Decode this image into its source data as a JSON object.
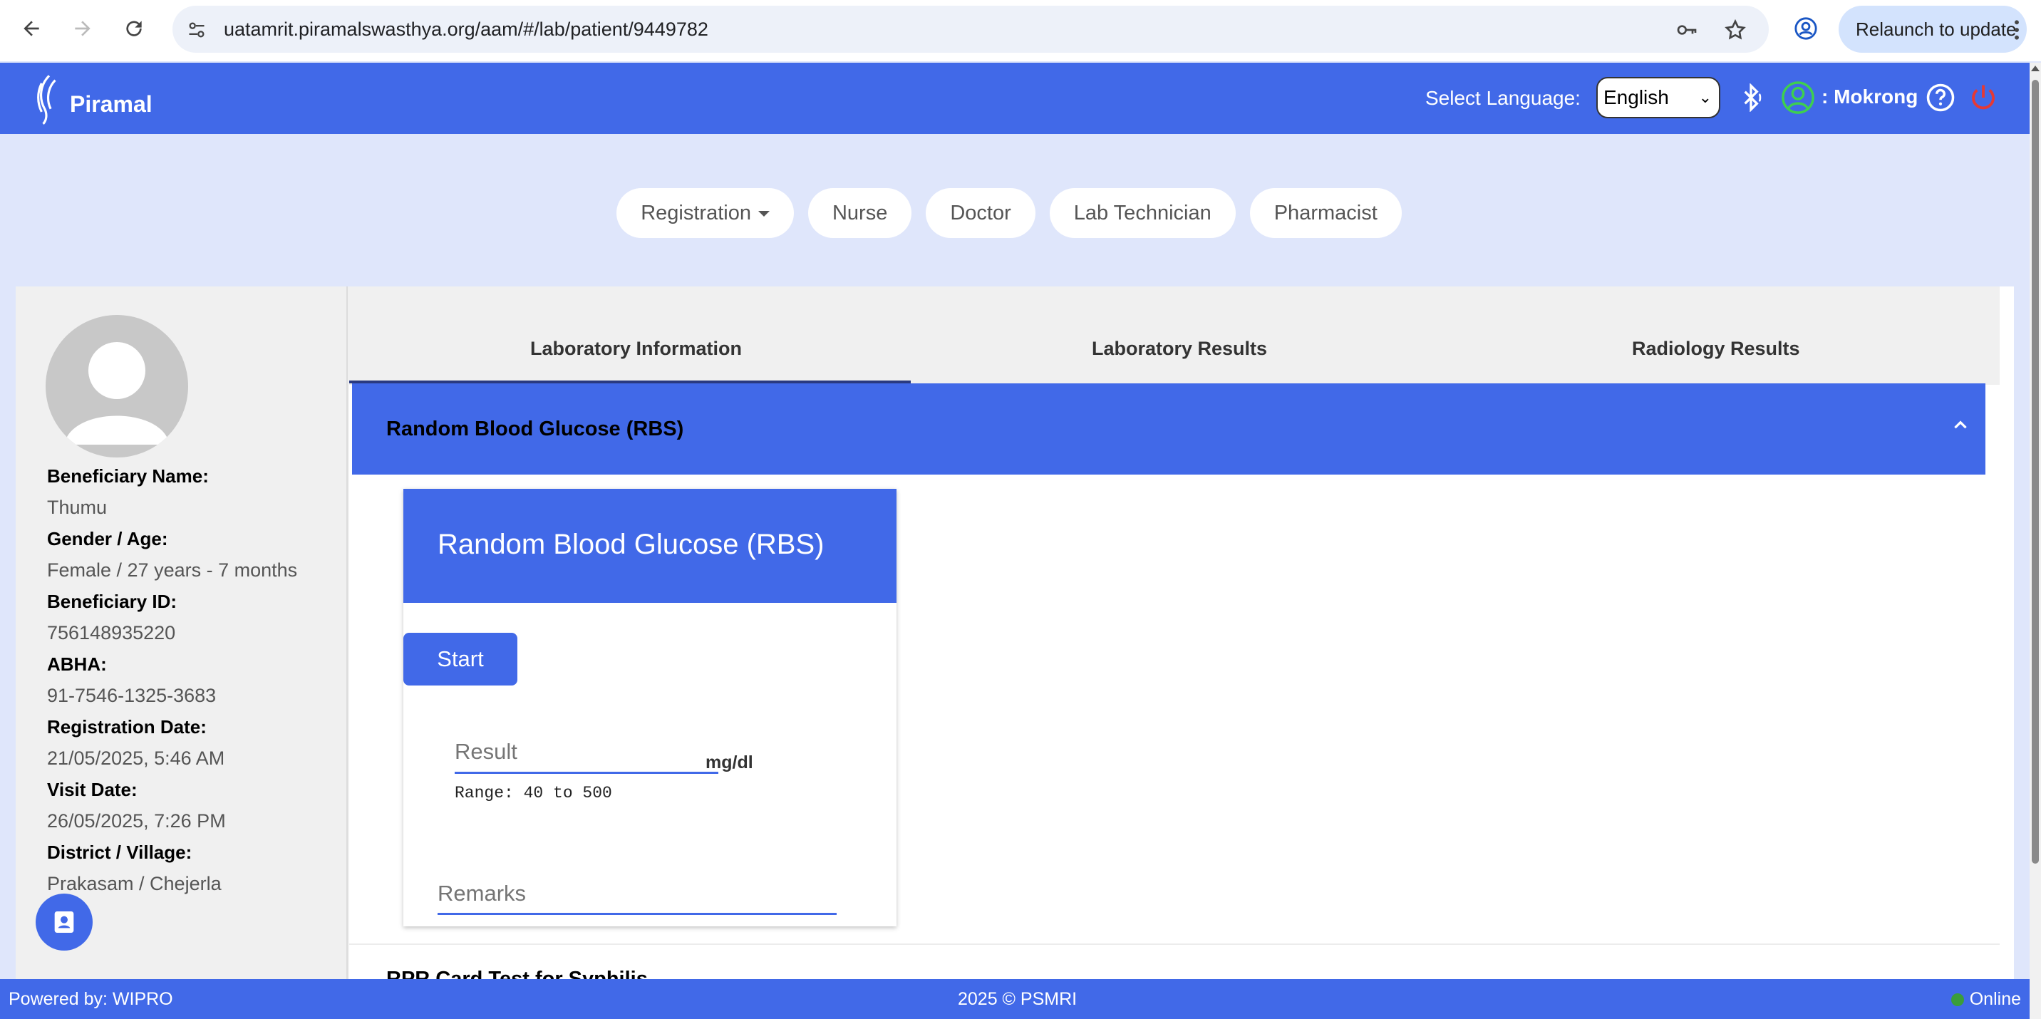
{
  "browser": {
    "url": "uatamrit.piramalswasthya.org/aam/#/lab/patient/9449782",
    "relaunch_label": "Relaunch to update"
  },
  "header": {
    "brand": "Piramal",
    "language_label": "Select Language:",
    "language_value": "English",
    "user_name": ": Mokrong",
    "colors": {
      "header_bg": "#4169e8",
      "power": "#e53935"
    }
  },
  "roles": [
    {
      "label": "Registration",
      "has_dropdown": true
    },
    {
      "label": "Nurse"
    },
    {
      "label": "Doctor"
    },
    {
      "label": "Lab Technician"
    },
    {
      "label": "Pharmacist"
    }
  ],
  "patient": {
    "fields": [
      {
        "label": "Beneficiary Name:",
        "value": "Thumu"
      },
      {
        "label": "Gender / Age:",
        "value": "Female / 27 years - 7 months"
      },
      {
        "label": "Beneficiary ID:",
        "value": "756148935220"
      },
      {
        "label": "ABHA:",
        "value": "91-7546-1325-3683"
      },
      {
        "label": "Registration Date:",
        "value": "21/05/2025, 5:46 AM"
      },
      {
        "label": "Visit Date:",
        "value": "26/05/2025, 7:26 PM"
      },
      {
        "label": "District / Village:",
        "value": "Prakasam / Chejerla"
      }
    ]
  },
  "tabs": [
    {
      "label": "Laboratory Information",
      "active": true
    },
    {
      "label": "Laboratory Results"
    },
    {
      "label": "Radiology Results"
    }
  ],
  "panel": {
    "title": "Random Blood Glucose (RBS)",
    "card_title": "Random Blood Glucose (RBS)",
    "start_label": "Start",
    "result_placeholder": "Result",
    "unit": "mg/dl",
    "range": "Range: 40 to 500",
    "remarks_placeholder": "Remarks"
  },
  "next_panel": {
    "title": "RPR Card Test for Syphilis"
  },
  "footer": {
    "powered": "Powered by: WIPRO",
    "copyright": "2025 © PSMRI",
    "status": "Online"
  }
}
